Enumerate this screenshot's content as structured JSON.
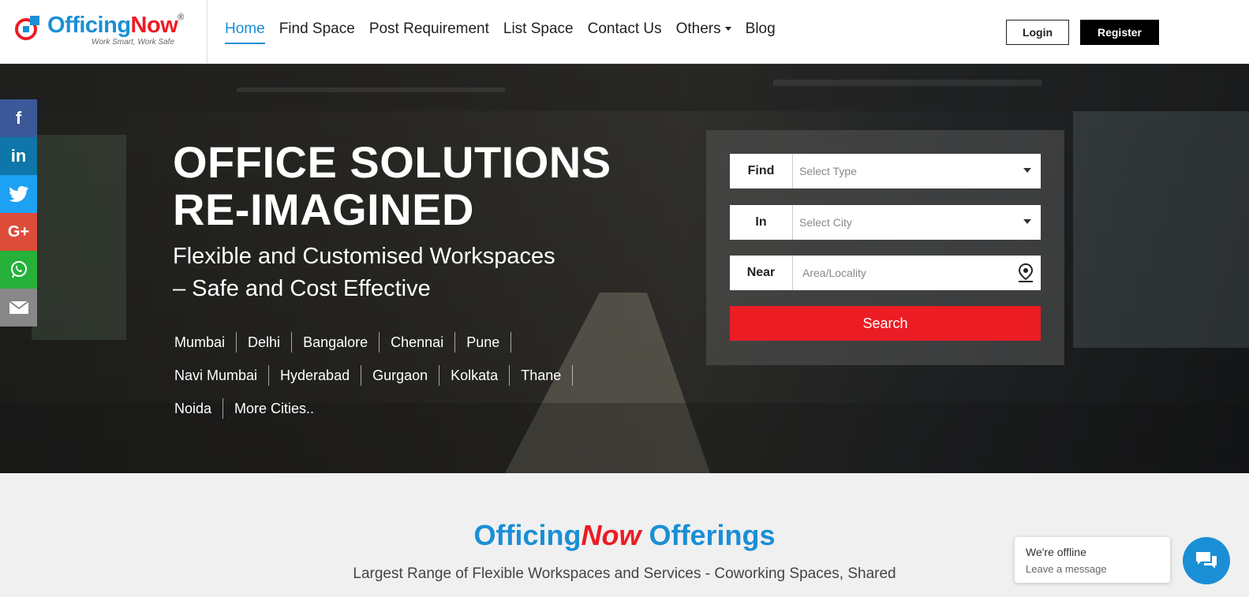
{
  "header": {
    "logo": {
      "brand_a": "Officing",
      "brand_b": "Now",
      "reg": "®",
      "tagline": "Work Smart, Work Safe"
    },
    "nav": [
      {
        "label": "Home"
      },
      {
        "label": "Find Space"
      },
      {
        "label": "Post Requirement"
      },
      {
        "label": "List Space"
      },
      {
        "label": "Contact Us"
      },
      {
        "label": "Others"
      },
      {
        "label": "Blog"
      }
    ],
    "login_label": "Login",
    "register_label": "Register"
  },
  "hero": {
    "title_line1": "OFFICE SOLUTIONS",
    "title_line2": "RE-IMAGINED",
    "subtitle_line1": "Flexible and Customised Workspaces",
    "subtitle_line2": "– Safe and Cost Effective",
    "cities_row1": [
      "Mumbai",
      "Delhi",
      "Bangalore",
      "Chennai",
      "Pune"
    ],
    "cities_row2": [
      "Navi Mumbai",
      "Hyderabad",
      "Gurgaon",
      "Kolkata",
      "Thane"
    ],
    "cities_row3": [
      "Noida",
      "More Cities.."
    ]
  },
  "search": {
    "find_label": "Find",
    "find_placeholder": "Select Type",
    "in_label": "In",
    "in_placeholder": "Select City",
    "near_label": "Near",
    "near_placeholder": "Area/Locality",
    "button_label": "Search"
  },
  "social": {
    "items": [
      {
        "icon": "facebook-icon",
        "glyph": "f",
        "color": "#3b5998"
      },
      {
        "icon": "linkedin-icon",
        "glyph": "in",
        "color": "#0e76a8"
      },
      {
        "icon": "twitter-icon",
        "glyph": "t",
        "color": "#1da1f2"
      },
      {
        "icon": "google-plus-icon",
        "glyph": "G+",
        "color": "#dd4b39"
      },
      {
        "icon": "whatsapp-icon",
        "glyph": "w",
        "color": "#25b13a"
      },
      {
        "icon": "email-icon",
        "glyph": "✉",
        "color": "#888888"
      }
    ]
  },
  "offerings": {
    "title_a": "Officing",
    "title_b": "Now",
    "title_c": "Offerings",
    "description": "Largest Range of Flexible Workspaces and Services - Coworking Spaces, Shared"
  },
  "chat": {
    "status": "We're offline",
    "prompt": "Leave a message"
  },
  "colors": {
    "brand_blue": "#1a8fd6",
    "brand_red": "#ec1c24"
  }
}
